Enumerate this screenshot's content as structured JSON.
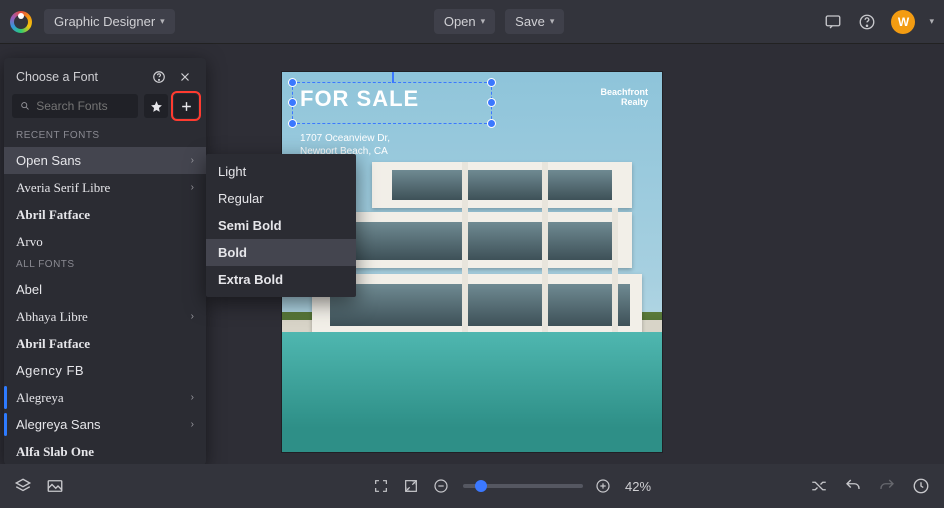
{
  "topbar": {
    "mode_label": "Graphic Designer",
    "open_label": "Open",
    "save_label": "Save",
    "avatar_letter": "W"
  },
  "font_panel": {
    "title": "Choose a Font",
    "search_placeholder": "Search Fonts",
    "recent_label": "RECENT FONTS",
    "all_label": "ALL FONTS",
    "recent": [
      {
        "name": "Open Sans",
        "has_children": true,
        "selected": true
      },
      {
        "name": "Averia Serif Libre",
        "has_children": true
      },
      {
        "name": "Abril Fatface"
      },
      {
        "name": "Arvo"
      }
    ],
    "all": [
      {
        "name": "Abel"
      },
      {
        "name": "Abhaya Libre",
        "has_children": true
      },
      {
        "name": "Abril Fatface"
      },
      {
        "name": "Agency FB"
      },
      {
        "name": "Alegreya",
        "has_children": true,
        "bluebar": true
      },
      {
        "name": "Alegreya Sans",
        "has_children": true,
        "bluebar": true
      },
      {
        "name": "Alfa Slab One"
      }
    ]
  },
  "weights": {
    "light": "Light",
    "regular": "Regular",
    "semibold": "Semi Bold",
    "bold": "Bold",
    "extrabold": "Extra Bold"
  },
  "canvas": {
    "headline": "FOR SALE",
    "realty_line1": "Beachfront",
    "realty_line2": "Realty",
    "addr_line1": "1707 Oceanview Dr,",
    "addr_line2": "Newport Beach, CA"
  },
  "bottombar": {
    "zoom_label": "42%"
  }
}
